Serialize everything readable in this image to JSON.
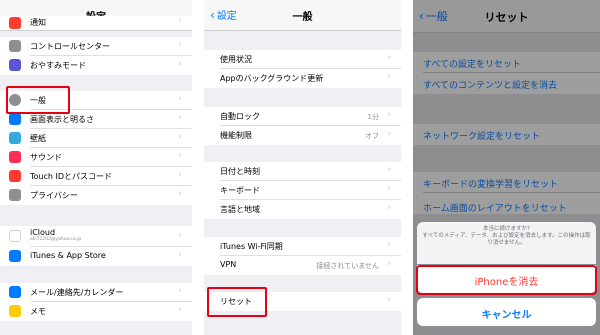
{
  "panel1": {
    "title": "設定",
    "rows": [
      {
        "label": "通知",
        "icon": "notification-icon",
        "color": "#ff3b30"
      },
      {
        "label": "コントロールセンター",
        "icon": "control-center-icon",
        "color": "#8e8e93"
      },
      {
        "label": "おやすみモード",
        "icon": "moon-icon",
        "color": "#5856d6"
      },
      {
        "label": "一般",
        "icon": "gear-icon",
        "color": "#8e8e93"
      },
      {
        "label": "画面表示と明るさ",
        "icon": "brightness-icon",
        "color": "#007aff"
      },
      {
        "label": "壁紙",
        "icon": "wallpaper-icon",
        "color": "#34aadc"
      },
      {
        "label": "サウンド",
        "icon": "sound-icon",
        "color": "#ff2d55"
      },
      {
        "label": "Touch IDとパスコード",
        "icon": "fingerprint-icon",
        "color": "#ff3b30"
      },
      {
        "label": "プライバシー",
        "icon": "hand-icon",
        "color": "#8e8e93"
      },
      {
        "label": "iCloud",
        "sub": "aki72202@yahoo.co.jp",
        "icon": "cloud-icon",
        "color": "#ffffff"
      },
      {
        "label": "iTunes & App Store",
        "icon": "app-store-icon",
        "color": "#007aff"
      },
      {
        "label": "メール/連絡先/カレンダー",
        "icon": "mail-icon",
        "color": "#007aff"
      },
      {
        "label": "メモ",
        "icon": "notes-icon",
        "color": "#ffcc00"
      }
    ]
  },
  "panel2": {
    "back": "設定",
    "title": "一般",
    "rows": [
      {
        "label": "使用状況",
        "value": ""
      },
      {
        "label": "Appのバックグラウンド更新",
        "value": ""
      },
      {
        "label": "自動ロック",
        "value": "1分"
      },
      {
        "label": "機能制限",
        "value": "オフ"
      },
      {
        "label": "日付と時刻",
        "value": ""
      },
      {
        "label": "キーボード",
        "value": ""
      },
      {
        "label": "言語と地域",
        "value": ""
      },
      {
        "label": "iTunes Wi-Fi同期",
        "value": ""
      },
      {
        "label": "VPN",
        "value": "接続されていません"
      },
      {
        "label": "リセット",
        "value": ""
      }
    ]
  },
  "panel3": {
    "back": "一般",
    "title": "リセット",
    "rows": [
      {
        "label": "すべての設定をリセット"
      },
      {
        "label": "すべてのコンテンツと設定を消去"
      },
      {
        "label": "ネットワーク設定をリセット"
      },
      {
        "label": "キーボードの変換学習をリセット"
      },
      {
        "label": "ホーム画面のレイアウトをリセット"
      }
    ],
    "sheet_message_1": "本当に続けますか?",
    "sheet_message_2": "すべてのメディア、データ、および設定を消去します。この操作は取り消せません。",
    "erase_button": "iPhoneを消去",
    "cancel_button": "キャンセル"
  }
}
